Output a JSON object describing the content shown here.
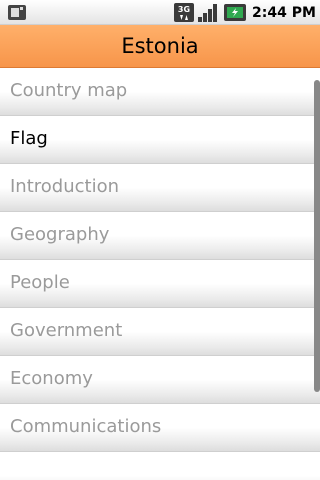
{
  "status_bar": {
    "time": "2:44 PM",
    "network_label": "3G",
    "icons": [
      "sd-card-icon",
      "3g-data-icon",
      "signal-icon",
      "battery-charging-icon"
    ]
  },
  "header": {
    "title": "Estonia"
  },
  "menu": {
    "items": [
      {
        "label": "Country map",
        "active": false
      },
      {
        "label": "Flag",
        "active": true
      },
      {
        "label": "Introduction",
        "active": false
      },
      {
        "label": "Geography",
        "active": false
      },
      {
        "label": "People",
        "active": false
      },
      {
        "label": "Government",
        "active": false
      },
      {
        "label": "Economy",
        "active": false
      },
      {
        "label": "Communications",
        "active": false
      }
    ]
  },
  "colors": {
    "title_bar": "#f7954a",
    "active_text": "#000000",
    "inactive_text": "#9a9a9a"
  }
}
